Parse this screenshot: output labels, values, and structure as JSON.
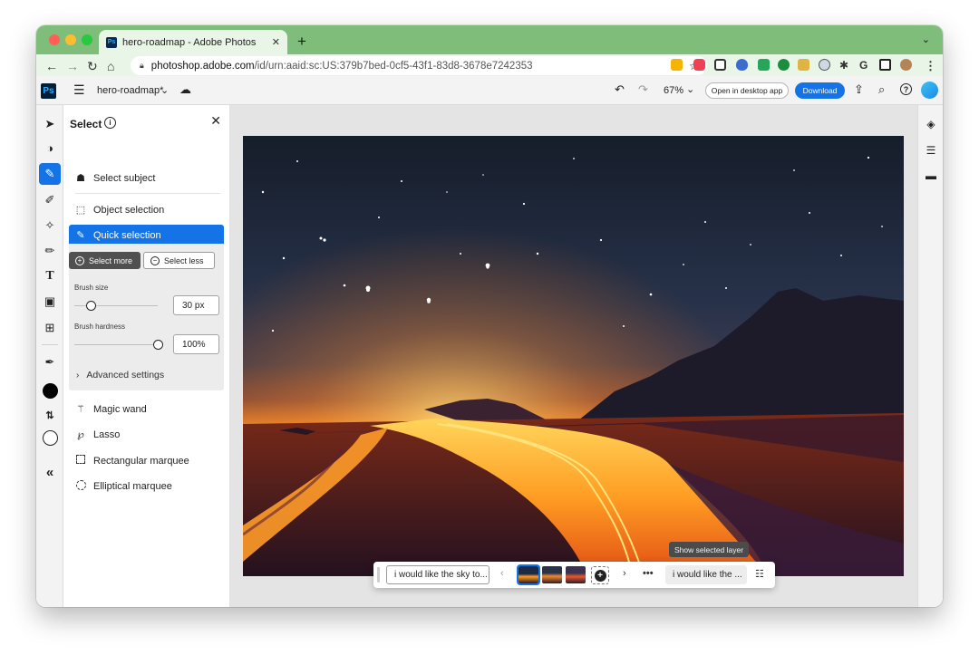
{
  "browser": {
    "tab_title": "hero-roadmap - Adobe Photos",
    "tab_favicon": "Ps",
    "url_host": "photoshop.adobe.com",
    "url_path": "/id/urn:aaid:sc:US:379b7bed-0cf5-43f1-83d8-3678e7242353",
    "new_tab": "+",
    "tab_menu": "⌄"
  },
  "app": {
    "logo": "Ps",
    "doc_name": "hero-roadmap*",
    "zoom": "67%",
    "open_desktop_label": "Open in desktop app",
    "download_label": "Download"
  },
  "panel": {
    "title": "Select",
    "select_subject": "Select subject",
    "object_selection": "Object selection",
    "quick_selection": "Quick selection",
    "select_more": "Select more",
    "select_less": "Select less",
    "brush_size_label": "Brush size",
    "brush_size_value": "30 px",
    "brush_size_level": 0.2,
    "brush_hardness_label": "Brush hardness",
    "brush_hardness_value": "100%",
    "brush_hardness_level": 1.0,
    "advanced_settings": "Advanced settings",
    "magic_wand": "Magic wand",
    "lasso": "Lasso",
    "rect_marquee": "Rectangular marquee",
    "ellip_marquee": "Elliptical marquee"
  },
  "taskbar": {
    "prompt_left": "i would like the sky to...",
    "prompt_right": "i would like the ...",
    "tooltip": "Show selected layer"
  },
  "colors": {
    "accent": "#1473e6",
    "titlebar": "#7fbd7a",
    "toolbar_bg": "#e9f5e6"
  }
}
